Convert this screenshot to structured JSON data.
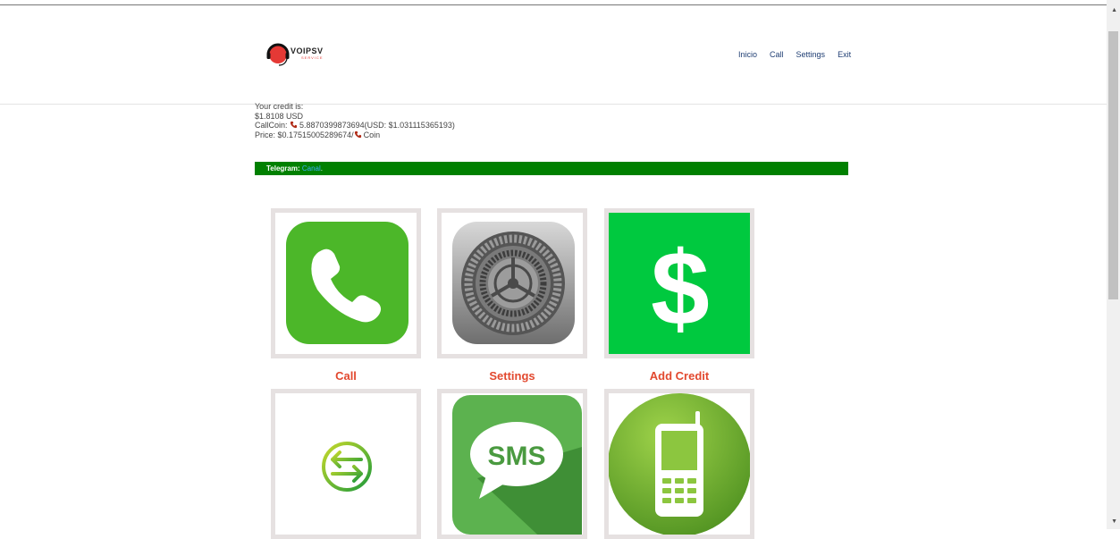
{
  "brand": {
    "name": "VOIPSV",
    "tagline": "SERVICE"
  },
  "nav": {
    "items": [
      "Inicio",
      "Call",
      "Settings",
      "Exit"
    ]
  },
  "credit": {
    "label": "Your credit is:",
    "amount": "$1.8108 USD",
    "callcoin_prefix": "CallCoin:",
    "callcoin_value": "5.8870399873694(USD: $1.031115365193)",
    "price_prefix": "Price: $0.17515005289674/",
    "price_suffix": "Coin"
  },
  "telegram": {
    "label": "Telegram:",
    "link": "Canal",
    "suffix": "."
  },
  "tiles": [
    {
      "label": "Call",
      "icon": "phone-icon"
    },
    {
      "label": "Settings",
      "icon": "gear-icon"
    },
    {
      "label": "Add Credit",
      "icon": "dollar-icon"
    },
    {
      "label": "",
      "icon": "transfer-arrows-icon"
    },
    {
      "label": "",
      "icon": "sms-icon"
    },
    {
      "label": "",
      "icon": "mobile-phone-icon"
    }
  ],
  "colors": {
    "nav_link": "#1f3e73",
    "telegram_bar": "#008000",
    "telegram_link": "#3ab0ff",
    "tile_label": "#e2492f",
    "tile_frame": "#e6e1e1"
  }
}
